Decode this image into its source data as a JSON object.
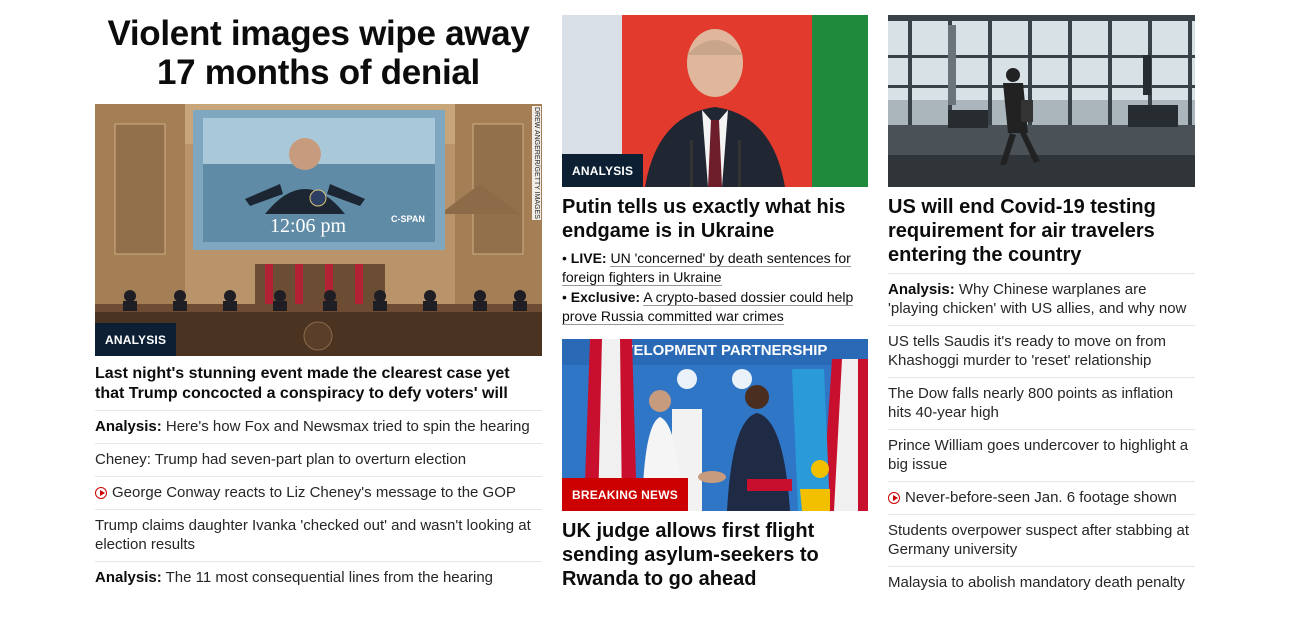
{
  "col1": {
    "headline": "Violent images wipe away 17 months of denial",
    "image": {
      "credit": "DREW ANGERER/GETTY IMAGES",
      "screen_time": "12:06 pm",
      "screen_logo": "C-SPAN",
      "badge": "ANALYSIS"
    },
    "lead": "Last night's stunning event made the clearest case yet that Trump concocted a conspiracy to defy voters' will",
    "items": [
      {
        "prefix": "Analysis:",
        "text": " Here's how Fox and Newsmax tried to spin the hearing"
      },
      {
        "text": "Cheney: Trump had seven-part plan to overturn election"
      },
      {
        "text": "George Conway reacts to Liz Cheney's message to the GOP",
        "icon": "play-icon"
      },
      {
        "text": "Trump claims daughter Ivanka 'checked out' and wasn't looking at election results"
      },
      {
        "prefix": "Analysis:",
        "text": " The 11 most consequential lines from the hearing"
      }
    ]
  },
  "col2": {
    "card1": {
      "badge": "ANALYSIS",
      "title": "Putin tells us exactly what his endgame is in Ukraine",
      "subs": [
        {
          "bullet": "•",
          "prefix": "LIVE:",
          "text": "UN 'concerned' by death sentences for foreign fighters in Ukraine"
        },
        {
          "bullet": "•",
          "prefix": "Exclusive:",
          "text": "A crypto-based dossier could help prove Russia committed war crimes"
        }
      ]
    },
    "card2": {
      "banner": "DEVELOPMENT PARTNERSHIP",
      "badge": "BREAKING NEWS",
      "title": "UK judge allows first flight sending asylum-seekers to Rwanda to go ahead"
    }
  },
  "col3": {
    "title": "US will end Covid-19 testing requirement for air travelers entering the country",
    "items": [
      {
        "prefix": "Analysis:",
        "text": " Why Chinese warplanes are 'playing chicken' with US allies, and why now"
      },
      {
        "text": "US tells Saudis it's ready to move on from Khashoggi murder to 'reset' relationship"
      },
      {
        "text": "The Dow falls nearly 800 points as inflation hits 40-year high"
      },
      {
        "text": "Prince William goes undercover to highlight a big issue"
      },
      {
        "text": "Never-before-seen Jan. 6 footage shown",
        "icon": "play-icon"
      },
      {
        "text": "Students overpower suspect after stabbing at Germany university"
      },
      {
        "text": "Malaysia to abolish mandatory death penalty"
      }
    ]
  },
  "colors": {
    "badge_dark": "#0c1f33",
    "badge_red": "#cc0000",
    "play": "#cc0000",
    "divider": "#e6e6e6"
  }
}
